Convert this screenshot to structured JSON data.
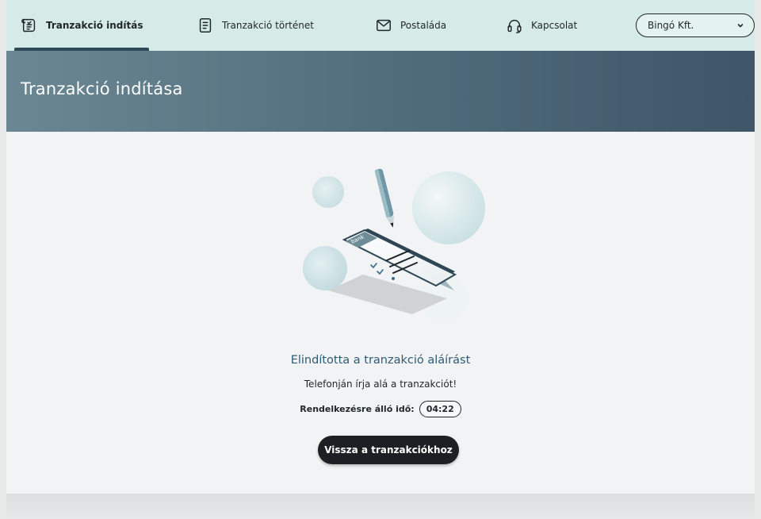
{
  "nav": {
    "items": [
      {
        "label": "Tranzakció indítás",
        "icon": "transaction-start-icon",
        "active": true
      },
      {
        "label": "Tranzakció történet",
        "icon": "document-icon",
        "active": false
      },
      {
        "label": "Postaláda",
        "icon": "mail-icon",
        "active": false
      },
      {
        "label": "Kapcsolat",
        "icon": "headset-icon",
        "active": false
      }
    ],
    "company": {
      "selected": "Bingó Kft."
    }
  },
  "hero": {
    "title": "Tranzakció indítása"
  },
  "illustration": {
    "phone_brand": "bank"
  },
  "status": {
    "title": "Elindította a tranzakció aláírást",
    "subtitle": "Telefonján írja alá a tranzakciót!",
    "time_label": "Rendelkezésre álló idő:",
    "time_value": "04:22"
  },
  "actions": {
    "back_label": "Vissza a tranzakciókhoz"
  },
  "colors": {
    "nav_bg": "#d6ebe8",
    "hero_start": "#6b8793",
    "hero_end": "#3e5668",
    "accent": "#2e5a74",
    "button_bg": "#1c2024"
  }
}
